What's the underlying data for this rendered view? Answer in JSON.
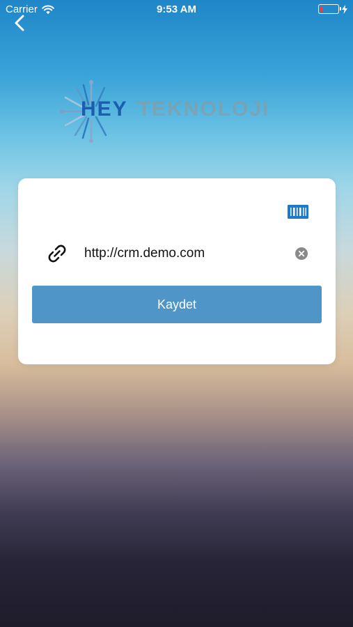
{
  "status_bar": {
    "carrier": "Carrier",
    "time": "9:53 AM",
    "wifi_icon": "wifi-icon",
    "battery_icon": "battery-low-icon",
    "charging_icon": "bolt-icon",
    "battery_level_percent": 15,
    "battery_color": "#e8413a"
  },
  "nav": {
    "back_icon": "chevron-left-icon"
  },
  "logo": {
    "part1": "HEY",
    "part2": "TEKNOLOJI",
    "brand_color": "#1a5fae"
  },
  "form": {
    "barcode_icon": "barcode-scanner-icon",
    "link_icon": "link-icon",
    "url_value": "http://crm.demo.com",
    "clear_icon": "clear-icon",
    "save_label": "Kaydet",
    "save_color": "#4f95c8"
  }
}
